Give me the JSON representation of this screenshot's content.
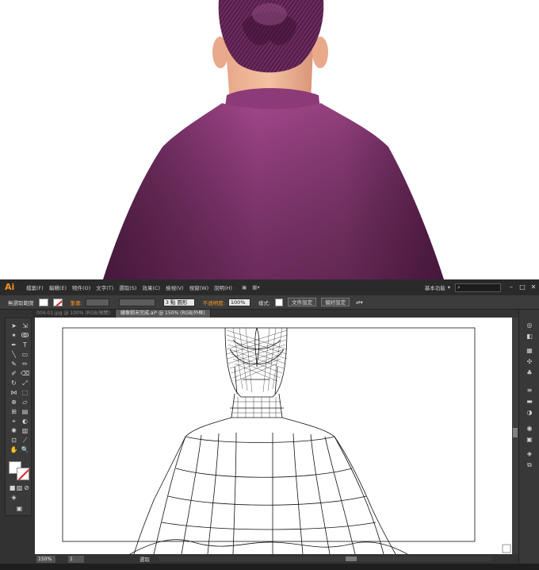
{
  "app": {
    "logo": "Ai",
    "menu": [
      "檔案(F)",
      "編輯(E)",
      "物件(O)",
      "文字(T)",
      "選取(S)",
      "效果(C)",
      "檢視(V)",
      "視窗(W)",
      "說明(H)"
    ],
    "workspace_label": "基本功能",
    "search_placeholder": ""
  },
  "control_bar": {
    "selection_label": "無選取範圍",
    "stroke_label": "筆畫:",
    "brush_value": "3 點 圓形",
    "opacity_label": "不透明度:",
    "opacity_value": "100%",
    "style_label": "樣式:",
    "doc_setup_button": "文件設定",
    "prefs_button": "偏好設定"
  },
  "tabs": [
    {
      "label": "004-01.jpg @ 100% (RGB/預覽)",
      "active": false
    },
    {
      "label": "繡像劉未完成.ai* @ 150% (RGB/外框)",
      "active": true
    }
  ],
  "status": {
    "zoom": "150%",
    "page": "1",
    "tool": "選取"
  },
  "colors": {
    "robe": "#8e3b78",
    "accent_orange": "#f7931e",
    "stroke_none_red": "#e02020",
    "ui_dark": "#323232"
  },
  "icons": {
    "selection_tool": "arrow-icon",
    "direct_selection_tool": "hollow-arrow-icon",
    "pen_tool": "pen-icon",
    "type_tool": "type-icon",
    "hand_tool": "hand-icon",
    "zoom_tool": "zoom-icon"
  }
}
